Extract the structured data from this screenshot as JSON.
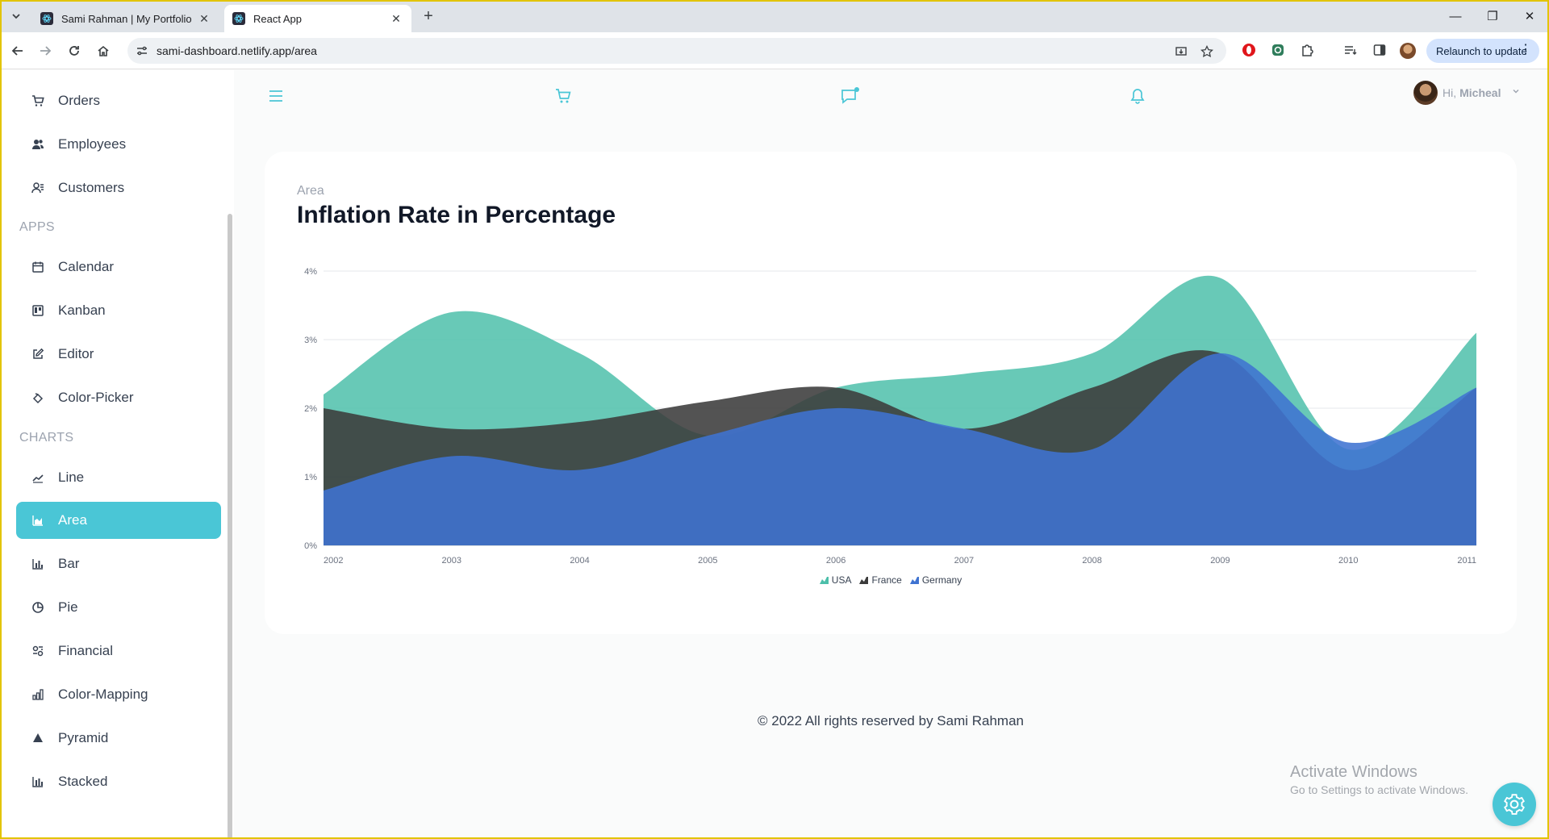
{
  "browser": {
    "tabs": [
      {
        "title": "Sami Rahman | My Portfolio",
        "active": false
      },
      {
        "title": "React App",
        "active": true
      }
    ],
    "url": "sami-dashboard.netlify.app/area",
    "relaunch_label": "Relaunch to update"
  },
  "sidebar": {
    "items_top": [
      {
        "label": "Orders",
        "icon": "cart-icon"
      },
      {
        "label": "Employees",
        "icon": "employees-icon"
      },
      {
        "label": "Customers",
        "icon": "customers-icon"
      }
    ],
    "apps_label": "APPS",
    "apps": [
      {
        "label": "Calendar",
        "icon": "calendar-icon"
      },
      {
        "label": "Kanban",
        "icon": "kanban-icon"
      },
      {
        "label": "Editor",
        "icon": "editor-icon"
      },
      {
        "label": "Color-Picker",
        "icon": "color-picker-icon"
      }
    ],
    "charts_label": "CHARTS",
    "charts": [
      {
        "label": "Line",
        "icon": "line-chart-icon"
      },
      {
        "label": "Area",
        "icon": "area-chart-icon",
        "active": true
      },
      {
        "label": "Bar",
        "icon": "bar-chart-icon"
      },
      {
        "label": "Pie",
        "icon": "pie-chart-icon"
      },
      {
        "label": "Financial",
        "icon": "financial-icon"
      },
      {
        "label": "Color-Mapping",
        "icon": "color-mapping-icon"
      },
      {
        "label": "Pyramid",
        "icon": "pyramid-icon"
      },
      {
        "label": "Stacked",
        "icon": "stacked-icon"
      }
    ],
    "accent_color": "#4ac6d6"
  },
  "header": {
    "greeting": "Hi,",
    "user_name": "Micheal"
  },
  "card": {
    "kicker": "Area",
    "title": "Inflation Rate in Percentage"
  },
  "chart_data": {
    "type": "area",
    "x": [
      "2002",
      "2003",
      "2004",
      "2005",
      "2006",
      "2007",
      "2008",
      "2009",
      "2010",
      "2011"
    ],
    "y_ticks": [
      "0%",
      "1%",
      "2%",
      "3%",
      "4%"
    ],
    "ylim": [
      0,
      4
    ],
    "grid": true,
    "legend_position": "bottom",
    "series": [
      {
        "name": "USA",
        "color": "#4dbfaa",
        "values": [
          2.2,
          3.4,
          2.8,
          1.6,
          2.3,
          2.5,
          2.8,
          3.9,
          1.4,
          3.1
        ]
      },
      {
        "name": "France",
        "color": "#3b3b3b",
        "values": [
          2.0,
          1.7,
          1.8,
          2.1,
          2.3,
          1.7,
          2.3,
          2.8,
          1.1,
          2.3
        ]
      },
      {
        "name": "Germany",
        "color": "#3f73d1",
        "values": [
          0.8,
          1.3,
          1.1,
          1.6,
          2.0,
          1.7,
          1.4,
          2.8,
          1.5,
          2.3
        ]
      }
    ]
  },
  "footer": {
    "text": "© 2022 All rights reserved by Sami Rahman"
  },
  "watermark": {
    "line1": "Activate Windows",
    "line2": "Go to Settings to activate Windows."
  }
}
